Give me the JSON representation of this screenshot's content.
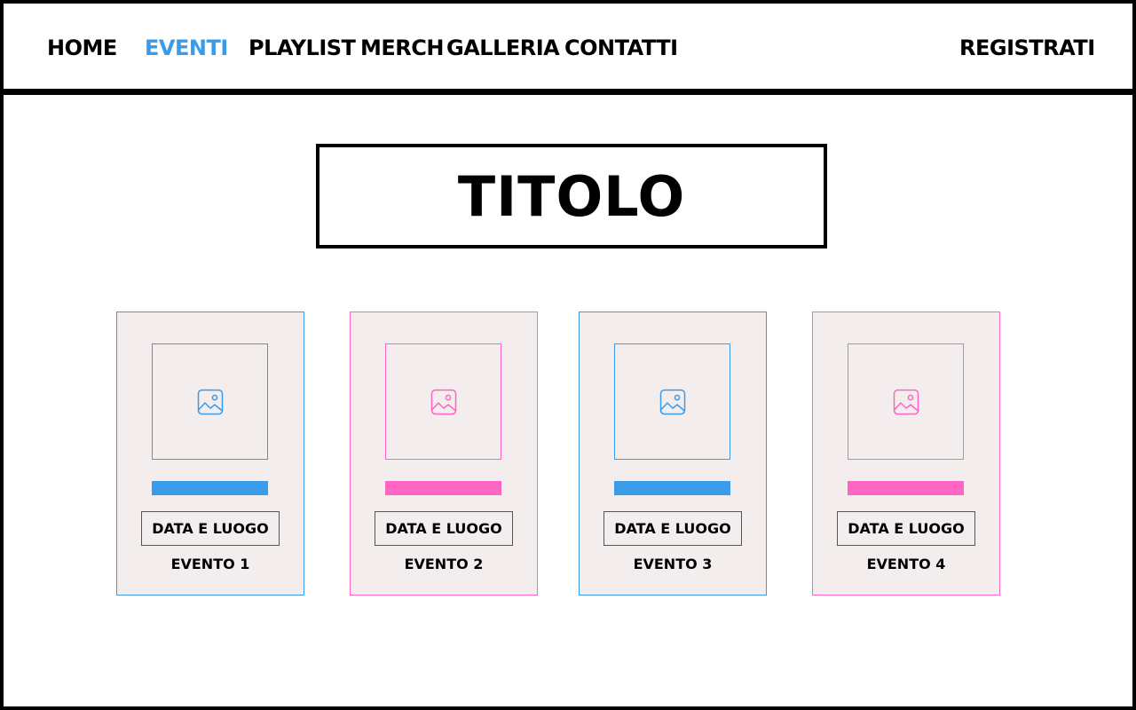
{
  "nav": {
    "items": [
      "HOME",
      "EVENTI",
      "PLAYLIST",
      "MERCH",
      "GALLERIA",
      "CONTATTI"
    ],
    "active": "EVENTI",
    "register": "REGISTRATI"
  },
  "title": "TITOLO",
  "colors": {
    "blue": "#3a9bea",
    "pink": "#ff66c4",
    "card_bg": "#f4eded"
  },
  "cards": [
    {
      "accent": "blue",
      "icon": "image-placeholder-icon",
      "button": "DATA E LUOGO",
      "name": "EVENTO 1"
    },
    {
      "accent": "pink",
      "icon": "image-placeholder-icon",
      "button": "DATA E LUOGO",
      "name": "EVENTO 2"
    },
    {
      "accent": "blue",
      "icon": "image-placeholder-icon",
      "button": "DATA E LUOGO",
      "name": "EVENTO 3"
    },
    {
      "accent": "pink",
      "icon": "image-placeholder-icon",
      "button": "DATA E LUOGO",
      "name": "EVENTO 4"
    }
  ]
}
